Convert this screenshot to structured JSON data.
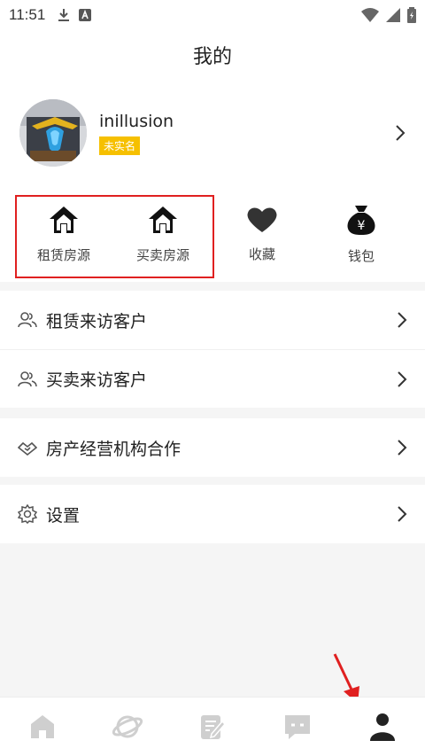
{
  "status": {
    "time": "11:51"
  },
  "header": {
    "title": "我的"
  },
  "profile": {
    "username": "inillusion",
    "badge": "未实名"
  },
  "quick_actions": [
    {
      "label": "租赁房源",
      "icon": "house-icon"
    },
    {
      "label": "买卖房源",
      "icon": "house-icon"
    },
    {
      "label": "收藏",
      "icon": "heart-icon"
    },
    {
      "label": "钱包",
      "icon": "money-bag-icon"
    }
  ],
  "menu": [
    {
      "label": "租赁来访客户",
      "icon": "users-icon"
    },
    {
      "label": "买卖来访客户",
      "icon": "users-icon"
    },
    {
      "label": "房产经营机构合作",
      "icon": "handshake-icon"
    },
    {
      "label": "设置",
      "icon": "gear-icon"
    }
  ],
  "tabbar": {
    "items": [
      {
        "name": "home-tab",
        "icon": "home-tab-icon",
        "active": false
      },
      {
        "name": "discover-tab",
        "icon": "planet-icon",
        "active": false
      },
      {
        "name": "publish-tab",
        "icon": "edit-icon",
        "active": false
      },
      {
        "name": "messages-tab",
        "icon": "chat-icon",
        "active": false
      },
      {
        "name": "profile-tab",
        "icon": "person-icon",
        "active": true
      }
    ]
  },
  "colors": {
    "accent_badge": "#f6c000",
    "highlight": "#e02020",
    "inactive_icon": "#cfcfcf",
    "active_icon": "#222222"
  }
}
